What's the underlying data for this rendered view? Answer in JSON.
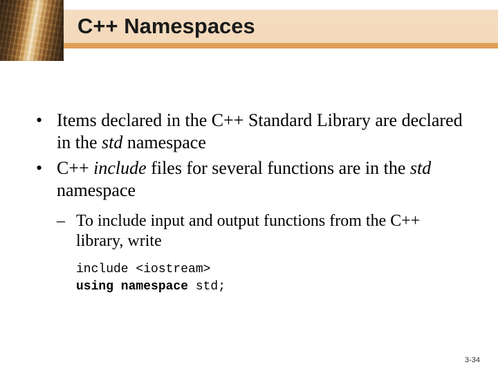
{
  "slide": {
    "title": "C++ Namespaces",
    "bullets": [
      {
        "pre": "Items declared in the C++ Standard Library are declared in the ",
        "em": "std",
        "post": " namespace"
      },
      {
        "pre": "C++ ",
        "em": "include",
        "mid": " files for several functions are in the ",
        "em2": "std",
        "post": " namespace"
      }
    ],
    "sub": {
      "text": "To include input and output functions from the C++ library, write"
    },
    "code": {
      "line1": "include <iostream>",
      "kw": "using namespace",
      "rest": " std;"
    },
    "footer": "3-34"
  }
}
